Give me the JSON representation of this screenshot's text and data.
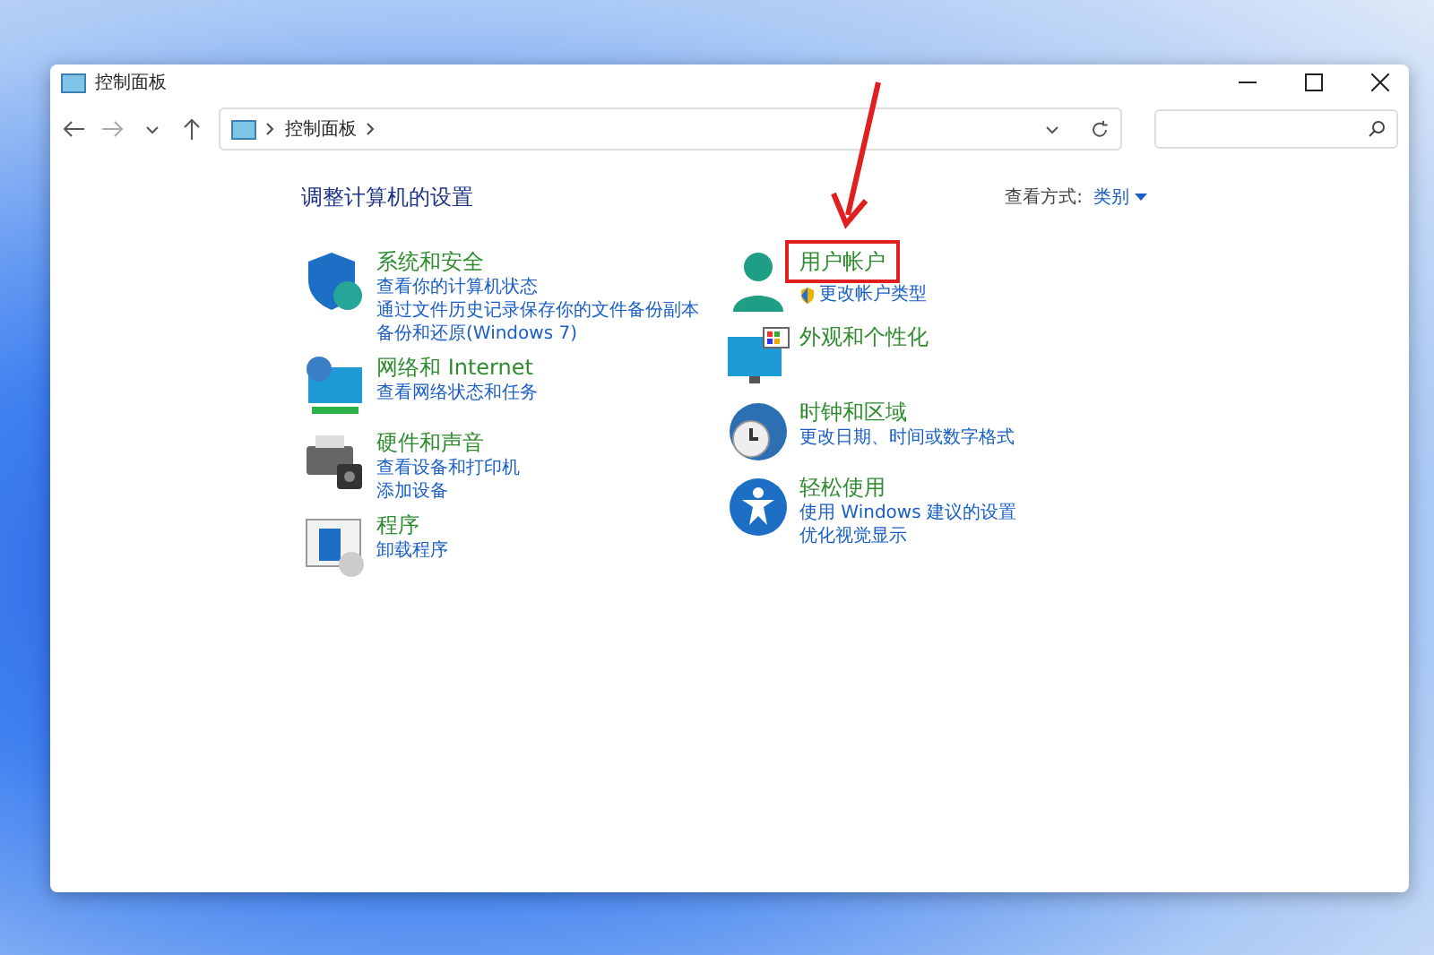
{
  "window": {
    "title": "控制面板"
  },
  "address": {
    "path": [
      "控制面板"
    ]
  },
  "heading": "调整计算机的设置",
  "view_by": {
    "label": "查看方式:",
    "value": "类别"
  },
  "columns": [
    {
      "categories": [
        {
          "kind": "shield",
          "title": "系统和安全",
          "highlighted": false,
          "links": [
            {
              "kind": "plain",
              "text": "查看你的计算机状态"
            },
            {
              "kind": "plain",
              "text": "通过文件历史记录保存你的文件备份副本"
            },
            {
              "kind": "plain",
              "text": "备份和还原(Windows 7)"
            }
          ]
        },
        {
          "kind": "network",
          "title": "网络和 Internet",
          "highlighted": false,
          "links": [
            {
              "kind": "plain",
              "text": "查看网络状态和任务"
            }
          ]
        },
        {
          "kind": "printer",
          "title": "硬件和声音",
          "highlighted": false,
          "links": [
            {
              "kind": "plain",
              "text": "查看设备和打印机"
            },
            {
              "kind": "plain",
              "text": "添加设备"
            }
          ]
        },
        {
          "kind": "program",
          "title": "程序",
          "highlighted": false,
          "links": [
            {
              "kind": "plain",
              "text": "卸载程序"
            }
          ]
        }
      ]
    },
    {
      "categories": [
        {
          "kind": "user",
          "title": "用户帐户",
          "highlighted": true,
          "links": [
            {
              "kind": "shield",
              "text": "更改帐户类型"
            }
          ]
        },
        {
          "kind": "display",
          "title": "外观和个性化",
          "highlighted": false
        },
        {
          "kind": "clock",
          "title": "时钟和区域",
          "highlighted": false,
          "links": [
            {
              "kind": "plain",
              "text": "更改日期、时间或数字格式"
            }
          ]
        },
        {
          "kind": "access",
          "title": "轻松使用",
          "highlighted": false,
          "links": [
            {
              "kind": "plain",
              "text": "使用 Windows 建议的设置"
            },
            {
              "kind": "plain",
              "text": "优化视觉显示"
            }
          ]
        }
      ]
    }
  ]
}
